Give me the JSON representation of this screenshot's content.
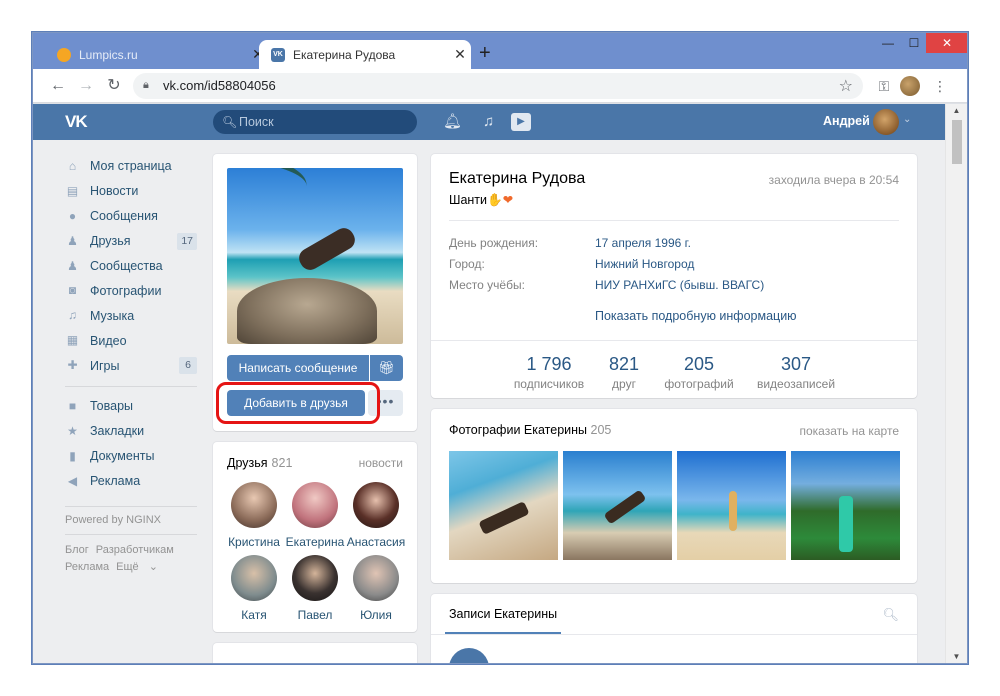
{
  "browser": {
    "tabs": [
      {
        "title": "Lumpics.ru",
        "active": false
      },
      {
        "title": "Екатерина Рудова",
        "active": true
      }
    ],
    "url": "vk.com/id58804056",
    "accent": "#6f8fce"
  },
  "vk": {
    "search_placeholder": "Поиск",
    "user_name": "Андрей",
    "brand_color": "#4a76a8",
    "menu": [
      {
        "label": "Моя страница",
        "icon": "home-icon",
        "count": ""
      },
      {
        "label": "Новости",
        "icon": "news-icon",
        "count": ""
      },
      {
        "label": "Сообщения",
        "icon": "messages-icon",
        "count": ""
      },
      {
        "label": "Друзья",
        "icon": "friends-icon",
        "count": "17"
      },
      {
        "label": "Сообщества",
        "icon": "groups-icon",
        "count": ""
      },
      {
        "label": "Фотографии",
        "icon": "camera-icon",
        "count": ""
      },
      {
        "label": "Музыка",
        "icon": "music-icon",
        "count": ""
      },
      {
        "label": "Видео",
        "icon": "video-icon",
        "count": ""
      },
      {
        "label": "Игры",
        "icon": "games-icon",
        "count": "6"
      }
    ],
    "menu2": [
      {
        "label": "Товары",
        "icon": "bag-icon"
      },
      {
        "label": "Закладки",
        "icon": "star-icon"
      },
      {
        "label": "Документы",
        "icon": "document-icon"
      },
      {
        "label": "Реклама",
        "icon": "megaphone-icon"
      }
    ],
    "powered": "Powered by NGINX",
    "footer_links": [
      "Блог",
      "Разработчикам",
      "Реклама",
      "Ещё"
    ]
  },
  "profile": {
    "send_message": "Написать сообщение",
    "add_friend": "Добавить в друзья",
    "name": "Екатерина Рудова",
    "last_seen": "заходила вчера в 20:54",
    "status": "Шанти",
    "info": [
      {
        "label": "День рождения:",
        "value": "17 апреля 1996 г."
      },
      {
        "label": "Город:",
        "value": "Нижний Новгород"
      },
      {
        "label": "Место учёбы:",
        "value": "НИУ РАНХиГС (бывш. ВВАГС)"
      }
    ],
    "show_more": "Показать подробную информацию",
    "stats": [
      {
        "num": "1 796",
        "label": "подписчиков"
      },
      {
        "num": "821",
        "label": "друг"
      },
      {
        "num": "205",
        "label": "фотографий"
      },
      {
        "num": "307",
        "label": "видеозаписей"
      }
    ]
  },
  "friends": {
    "title": "Друзья",
    "count": "821",
    "news": "новости",
    "list": [
      {
        "name": "Кристина"
      },
      {
        "name": "Екатерина"
      },
      {
        "name": "Анастасия"
      },
      {
        "name": "Катя"
      },
      {
        "name": "Павел"
      },
      {
        "name": "Юлия"
      }
    ]
  },
  "photos": {
    "title": "Фотографии Екатерины",
    "count": "205",
    "map_link": "показать на карте"
  },
  "wall": {
    "tab": "Записи Екатерины"
  }
}
